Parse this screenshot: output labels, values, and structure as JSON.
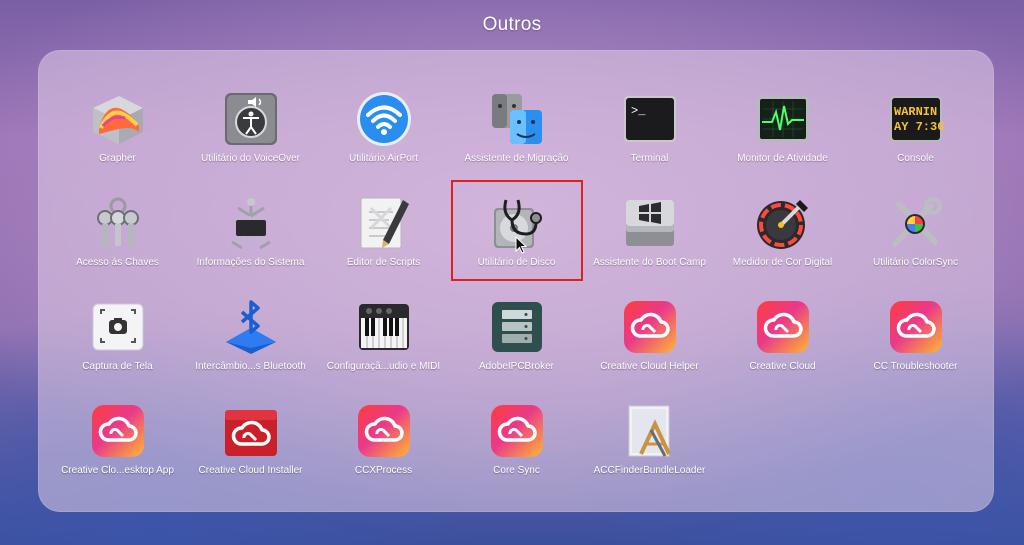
{
  "folder": {
    "title": "Outros"
  },
  "apps": [
    {
      "label": "Grapher",
      "icon": "grapher-icon"
    },
    {
      "label": "Utilitário do VoiceOver",
      "icon": "voiceover-icon"
    },
    {
      "label": "Utilitário AirPort",
      "icon": "airport-icon"
    },
    {
      "label": "Assistente de Migração",
      "icon": "migration-icon"
    },
    {
      "label": "Terminal",
      "icon": "terminal-icon"
    },
    {
      "label": "Monitor de Atividade",
      "icon": "activity-monitor-icon"
    },
    {
      "label": "Console",
      "icon": "console-icon"
    },
    {
      "label": "Acesso às Chaves",
      "icon": "keychain-icon"
    },
    {
      "label": "Informações do Sistema",
      "icon": "system-info-icon"
    },
    {
      "label": "Editor de Scripts",
      "icon": "script-editor-icon"
    },
    {
      "label": "Utilitário de Disco",
      "icon": "disk-utility-icon"
    },
    {
      "label": "Assistente do Boot Camp",
      "icon": "boot-camp-icon"
    },
    {
      "label": "Medidor de Cor Digital",
      "icon": "color-meter-icon"
    },
    {
      "label": "Utilitário ColorSync",
      "icon": "colorsync-icon"
    },
    {
      "label": "Captura de Tela",
      "icon": "screenshot-icon"
    },
    {
      "label": "Intercâmbio...s Bluetooth",
      "icon": "bluetooth-icon"
    },
    {
      "label": "Configuraçã...udio e MIDI",
      "icon": "midi-icon"
    },
    {
      "label": "AdobeIPCBroker",
      "icon": "adobe-ipc-icon"
    },
    {
      "label": "Creative Cloud Helper",
      "icon": "creative-cloud-icon"
    },
    {
      "label": "Creative Cloud",
      "icon": "creative-cloud-icon"
    },
    {
      "label": "CC Troubleshooter",
      "icon": "creative-cloud-icon"
    },
    {
      "label": "Creative Clo...esktop App",
      "icon": "creative-cloud-icon"
    },
    {
      "label": "Creative Cloud Installer",
      "icon": "creative-cloud-installer-icon"
    },
    {
      "label": "CCXProcess",
      "icon": "creative-cloud-icon"
    },
    {
      "label": "Core Sync",
      "icon": "creative-cloud-icon"
    },
    {
      "label": "ACCFinderBundleLoader",
      "icon": "bundle-loader-icon"
    }
  ],
  "console_icon_text": [
    "WARNIN",
    "AY 7:36"
  ],
  "terminal_icon_text": ">_",
  "colors": {
    "highlight": "#e0201e",
    "panel": "#e1cde8",
    "creative_cloud": "#e1343f"
  }
}
